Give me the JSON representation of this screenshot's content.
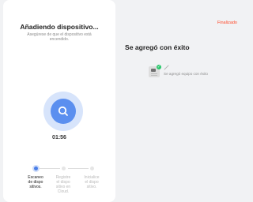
{
  "adding_panel": {
    "title": "Añadiendo dispositivo...",
    "subtitle": "Asegúrese de que el dispositivo está encendido.",
    "timer": "01:56",
    "steps": [
      {
        "label": "Escaneo\nde dispo\nsitivos.",
        "state": "active"
      },
      {
        "label": "Registre\nel dispo\nsitivo en\nCloud.",
        "state": "pending"
      },
      {
        "label": "Inicialice\nel dispo\nsitivo.",
        "state": "pending"
      }
    ]
  },
  "success_panel": {
    "finish_link": "Finalizado",
    "title": "Se agregó con éxito",
    "device_status": "Se agregó equipo con éxito"
  },
  "icons": {
    "scan": "search-icon",
    "status": "check-icon",
    "edit": "pencil-icon",
    "device": "device-icon"
  },
  "colors": {
    "accent": "#5b8fef",
    "finish": "#ff4a2a",
    "success": "#2ac76b"
  }
}
